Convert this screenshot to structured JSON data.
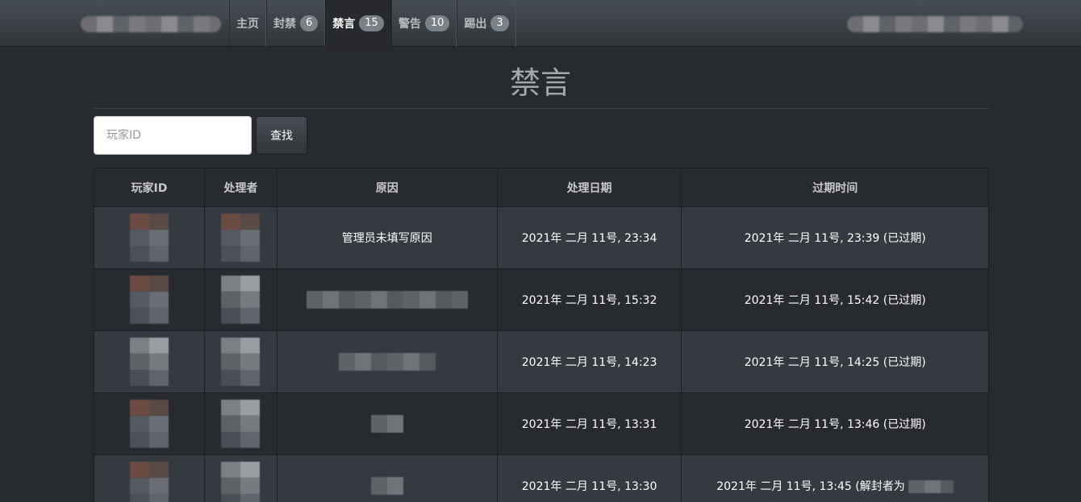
{
  "nav": {
    "items": [
      {
        "label": "主页",
        "badge": ""
      },
      {
        "label": "封禁",
        "badge": "6"
      },
      {
        "label": "禁言",
        "badge": "15",
        "active": true
      },
      {
        "label": "警告",
        "badge": "10"
      },
      {
        "label": "踢出",
        "badge": "3"
      }
    ]
  },
  "page": {
    "title": "禁言"
  },
  "search": {
    "placeholder": "玩家ID",
    "button_label": "查找"
  },
  "table": {
    "headers": [
      "玩家ID",
      "处理者",
      "原因",
      "处理日期",
      "过期时间"
    ],
    "rows": [
      {
        "reason": "管理员未填写原因",
        "date": "2021年 二月 11号, 23:34",
        "expires": "2021年 二月 11号, 23:39 (已过期)"
      },
      {
        "reason": "",
        "date": "2021年 二月 11号, 15:32",
        "expires": "2021年 二月 11号, 15:42 (已过期)"
      },
      {
        "reason": "",
        "date": "2021年 二月 11号, 14:23",
        "expires": "2021年 二月 11号, 14:25 (已过期)"
      },
      {
        "reason": "",
        "date": "2021年 二月 11号, 13:31",
        "expires": "2021年 二月 11号, 13:46 (已过期)"
      },
      {
        "reason": "",
        "date": "2021年 二月 11号, 13:30",
        "expires": "2021年 二月 11号, 13:45 (解封者为"
      }
    ]
  },
  "colors": {
    "background": "#272b30",
    "badge": "#7a8288",
    "navbar": "#3a3f44"
  }
}
